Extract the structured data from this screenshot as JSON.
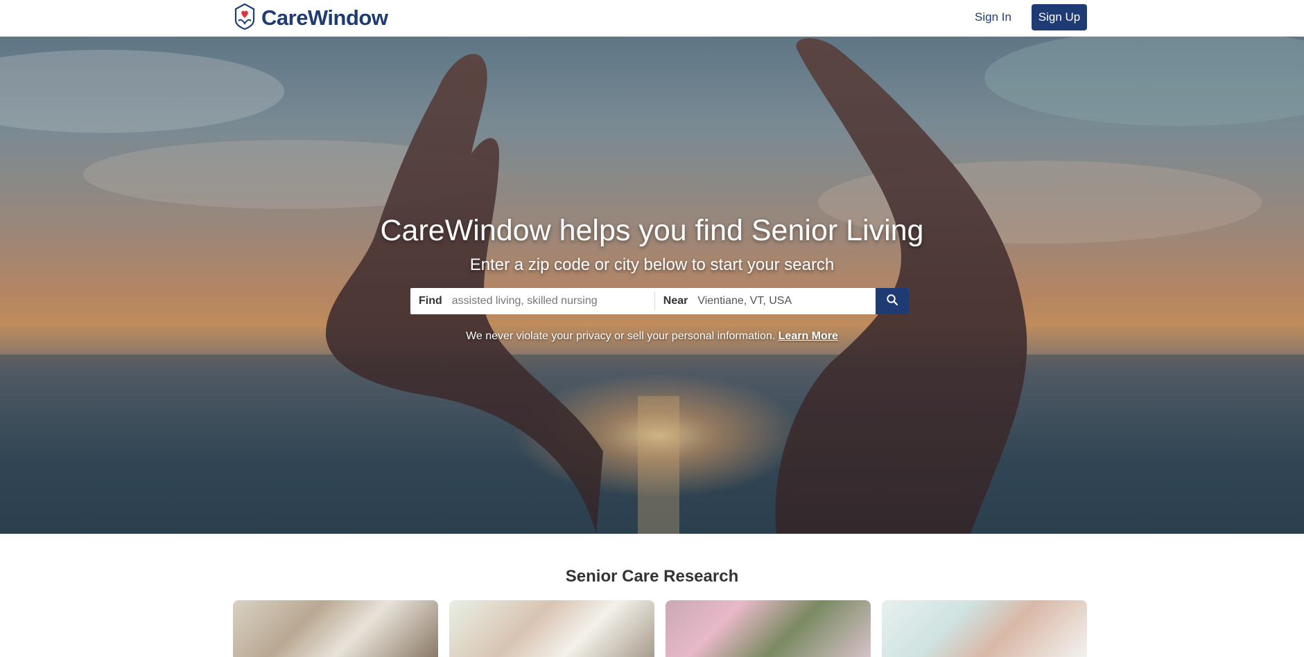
{
  "header": {
    "logo_text": "CareWindow",
    "logo_icon": "hands-heart-icon",
    "signin_label": "Sign In",
    "signup_label": "Sign Up",
    "brand_color": "#1f3b73"
  },
  "hero": {
    "title": "CareWindow helps you find Senior Living",
    "subtitle": "Enter a zip code or city below to start your search",
    "search": {
      "find_label": "Find",
      "find_placeholder": "assisted living, skilled nursing",
      "near_label": "Near",
      "near_value": "Vientiane, VT, USA",
      "button_icon": "search-icon"
    },
    "privacy_text": "We never violate your privacy or sell your personal information.",
    "privacy_link": "Learn More"
  },
  "research": {
    "title": "Senior Care Research"
  }
}
